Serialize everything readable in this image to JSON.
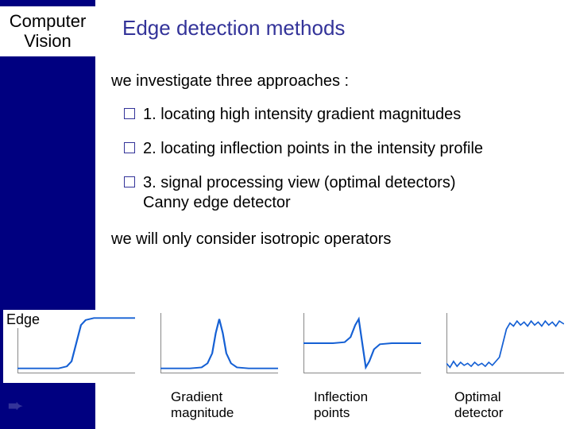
{
  "sidebar": {
    "title_line1": "Computer",
    "title_line2": "Vision"
  },
  "title": "Edge detection methods",
  "intro": "we investigate three approaches :",
  "bullets": [
    {
      "text": "1. locating high intensity gradient magnitudes"
    },
    {
      "text": "2. locating inflection points in the intensity profile"
    },
    {
      "text": "3. signal processing view (optimal detectors)",
      "sub": "Canny edge detector"
    }
  ],
  "closing": "we will only consider isotropic operators",
  "edge_label": "Edge",
  "arrow_glyph": "➨",
  "captions": {
    "gradient": {
      "line1": "Gradient",
      "line2": "magnitude"
    },
    "inflection": {
      "line1": "Inflection",
      "line2": "points"
    },
    "optimal": {
      "line1": "Optimal",
      "line2": "detector"
    }
  },
  "chart_data": [
    {
      "type": "line",
      "name": "edge-step",
      "title": "",
      "xlabel": "",
      "ylabel": "",
      "x": [
        -10,
        -8,
        -6,
        -4,
        -2,
        -1,
        0,
        1,
        2,
        4,
        6,
        8,
        10
      ],
      "values": [
        -1.0,
        -1.0,
        -1.0,
        -0.99,
        -0.9,
        -0.6,
        0.0,
        0.6,
        0.9,
        0.99,
        1.0,
        1.0,
        1.0
      ],
      "xlim": [
        -10,
        10
      ],
      "ylim": [
        -1.2,
        1.2
      ]
    },
    {
      "type": "line",
      "name": "gradient-magnitude",
      "title": "",
      "xlabel": "",
      "ylabel": "",
      "x": [
        -10,
        -6,
        -4,
        -3,
        -2,
        -1,
        0,
        1,
        2,
        3,
        4,
        6,
        10
      ],
      "values": [
        0,
        0,
        0.02,
        0.08,
        0.25,
        0.55,
        0.7,
        0.55,
        0.25,
        0.08,
        0.02,
        0,
        0
      ],
      "xlim": [
        -10,
        10
      ],
      "ylim": [
        -0.1,
        0.8
      ]
    },
    {
      "type": "line",
      "name": "inflection-derivative",
      "title": "",
      "xlabel": "",
      "ylabel": "",
      "x": [
        -10,
        -6,
        -4,
        -3,
        -2,
        -1.2,
        -0.6,
        0,
        0.6,
        1.2,
        2,
        3,
        4,
        6,
        10
      ],
      "values": [
        0,
        0,
        0.01,
        0.06,
        0.18,
        0.25,
        0.15,
        0,
        -0.15,
        -0.25,
        -0.18,
        -0.06,
        -0.01,
        0,
        0
      ],
      "xlim": [
        -10,
        10
      ],
      "ylim": [
        -0.3,
        0.3
      ]
    },
    {
      "type": "line",
      "name": "optimal-noisy-step",
      "title": "",
      "xlabel": "",
      "ylabel": "",
      "x": [
        -10,
        -8,
        -6,
        -4,
        -2,
        -1,
        0,
        1,
        2,
        4,
        6,
        8,
        10
      ],
      "values": [
        -1.0,
        -1.0,
        -1.0,
        -0.99,
        -0.9,
        -0.6,
        0.0,
        0.6,
        0.9,
        0.99,
        1.0,
        1.0,
        1.0
      ],
      "noise_amplitude": 0.12,
      "xlim": [
        -10,
        10
      ],
      "ylim": [
        -1.5,
        1.5
      ]
    }
  ]
}
